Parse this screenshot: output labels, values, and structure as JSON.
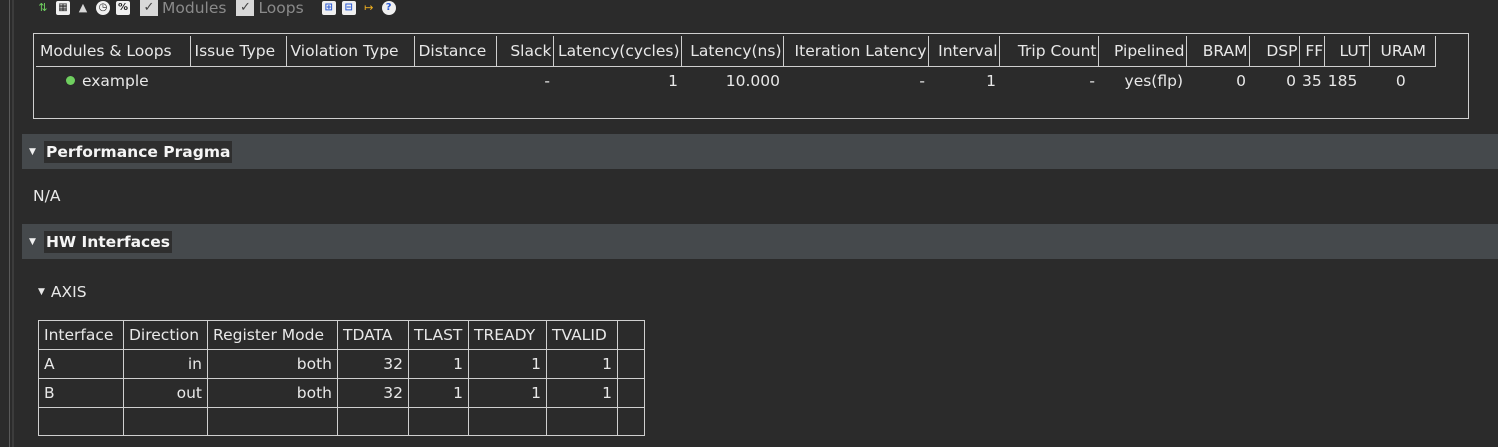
{
  "toolbar": {
    "icons": [
      "tree-icon",
      "grid-icon",
      "warning-icon",
      "clock-icon",
      "percent-icon",
      "expand-icon",
      "collapse-icon",
      "arrow-icon",
      "help-icon"
    ],
    "percent_label": "%",
    "modules_label": "Modules",
    "loops_label": "Loops"
  },
  "modules_table": {
    "headers": [
      "Modules & Loops",
      "Issue Type",
      "Violation Type",
      "Distance",
      "Slack",
      "Latency(cycles)",
      "Latency(ns)",
      "Iteration Latency",
      "Interval",
      "Trip Count",
      "Pipelined",
      "BRAM",
      "DSP",
      "FF",
      "LUT",
      "URAM"
    ],
    "row": {
      "name": "example",
      "issue_type": "",
      "violation_type": "",
      "distance": "",
      "slack": "-",
      "latency_cycles": "1",
      "latency_ns": "10.000",
      "iteration_latency": "-",
      "interval": "1",
      "trip_count": "-",
      "pipelined": "yes(flp)",
      "bram": "0",
      "dsp": "0",
      "ff": "35",
      "lut": "185",
      "uram": "0"
    }
  },
  "performance_pragma": {
    "title": "Performance Pragma",
    "value": "N/A"
  },
  "hw_interfaces": {
    "title": "HW Interfaces",
    "axis_title": "AXIS",
    "headers": [
      "Interface",
      "Direction",
      "Register Mode",
      "TDATA",
      "TLAST",
      "TREADY",
      "TVALID"
    ],
    "rows": [
      {
        "interface": "A",
        "direction": "in",
        "register_mode": "both",
        "tdata": "32",
        "tlast": "1",
        "tready": "1",
        "tvalid": "1"
      },
      {
        "interface": "B",
        "direction": "out",
        "register_mode": "both",
        "tdata": "32",
        "tlast": "1",
        "tready": "1",
        "tvalid": "1"
      }
    ]
  }
}
